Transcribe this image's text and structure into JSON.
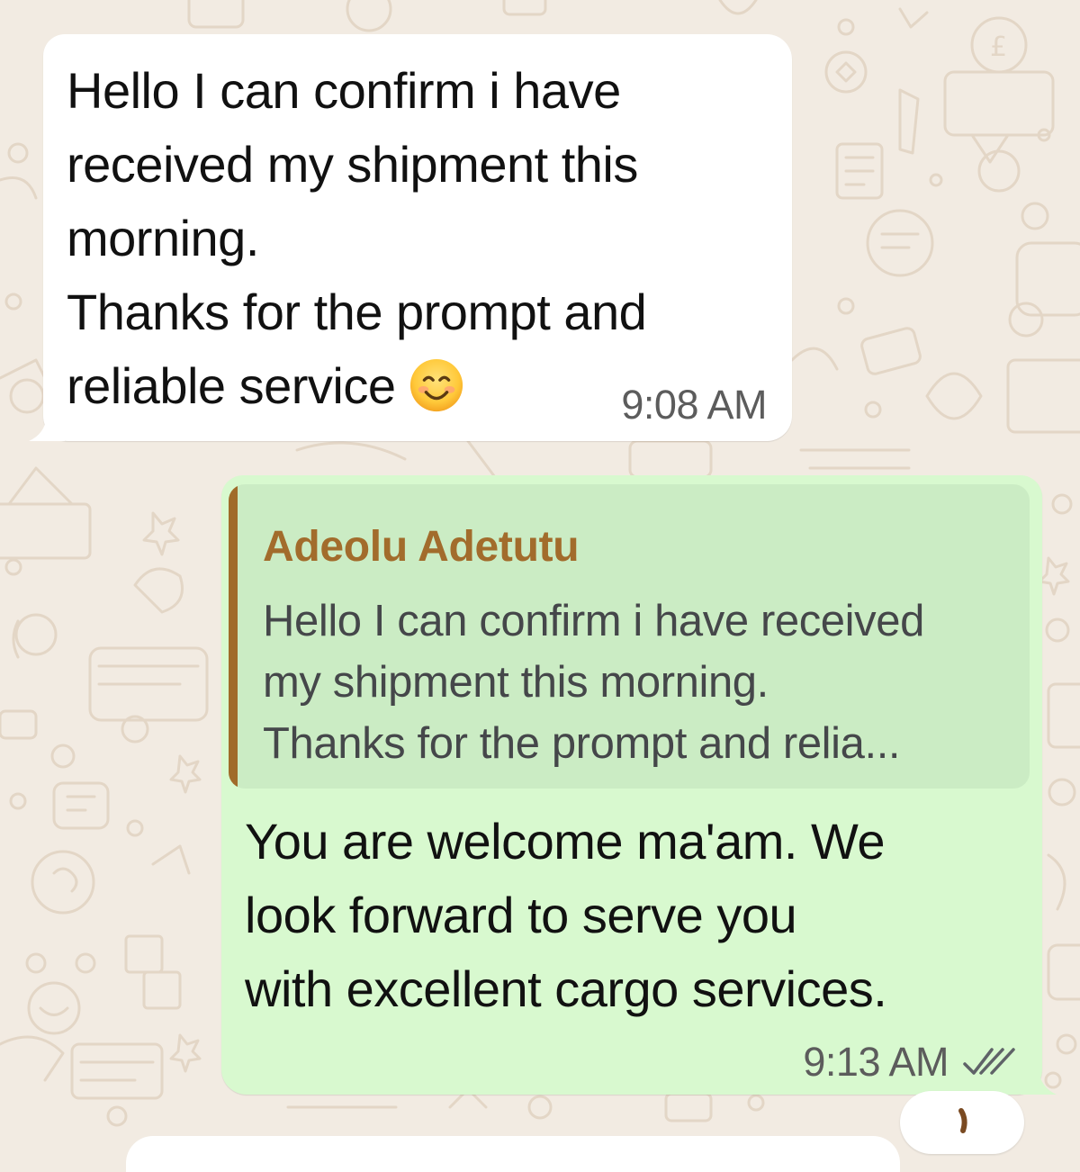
{
  "incoming_message": {
    "lines": [
      "Hello I can confirm i have",
      "received my shipment this",
      "morning.",
      "Thanks for the prompt and",
      "reliable service"
    ],
    "emoji": "smiling-face-icon",
    "time": "9:08 AM"
  },
  "outgoing_message": {
    "quote": {
      "author": "Adeolu Adetutu",
      "lines": [
        "Hello I can confirm i have received",
        "my shipment this morning.",
        "Thanks for the prompt and relia..."
      ]
    },
    "lines": [
      "You are welcome ma'am. We",
      "look forward to serve you",
      "with excellent cargo services."
    ],
    "time": "9:13 AM",
    "status": "read-double-check-icon"
  },
  "colors": {
    "wallpaper": "#f2ebe2",
    "wallpaper_doodle": "#e3d6c6",
    "incoming_bubble": "#ffffff",
    "outgoing_bubble": "#d8f9cf",
    "quote_background": "#cbecc4",
    "quote_author": "#a26c2c",
    "read_ticks": "#5f6368"
  }
}
